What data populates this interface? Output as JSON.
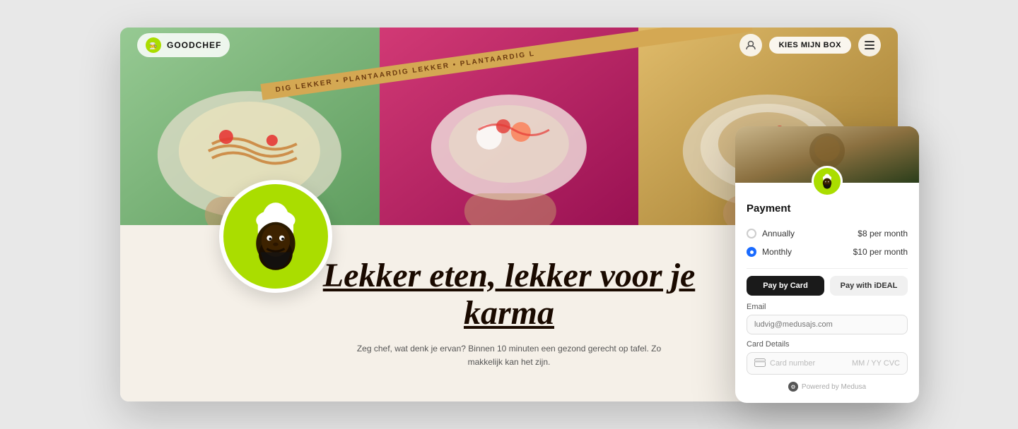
{
  "page": {
    "background_color": "#e8e8e8"
  },
  "browser": {
    "nav": {
      "logo_text": "GOODCHEF",
      "kies_btn_label": "KIES MIJN BOX"
    },
    "banner": {
      "text": "DIG LEKKER • PLANTAARDIG LEKKER • PLANTAARDIG L"
    },
    "hero": {
      "heading": "Lekker eten, lekker voor je karma",
      "subtext": "Zeg chef, wat denk je ervan? Binnen 10 minuten een gezond gerecht op tafel. Zo makkelijk kan het zijn."
    }
  },
  "payment_card": {
    "title": "Payment",
    "options": [
      {
        "id": "annually",
        "label": "Annually",
        "price": "$8 per month",
        "active": false
      },
      {
        "id": "monthly",
        "label": "Monthly",
        "price": "$10 per month",
        "active": true
      }
    ],
    "methods": [
      {
        "id": "card",
        "label": "Pay by Card",
        "active": true
      },
      {
        "id": "ideal",
        "label": "Pay with iDEAL",
        "active": false
      }
    ],
    "email_label": "Email",
    "email_placeholder": "ludvig@medusajs.com",
    "card_details_label": "Card Details",
    "card_number_placeholder": "Card number",
    "card_date_placeholder": "MM / YY  CVC",
    "powered_by": "Powered by Medusa"
  }
}
